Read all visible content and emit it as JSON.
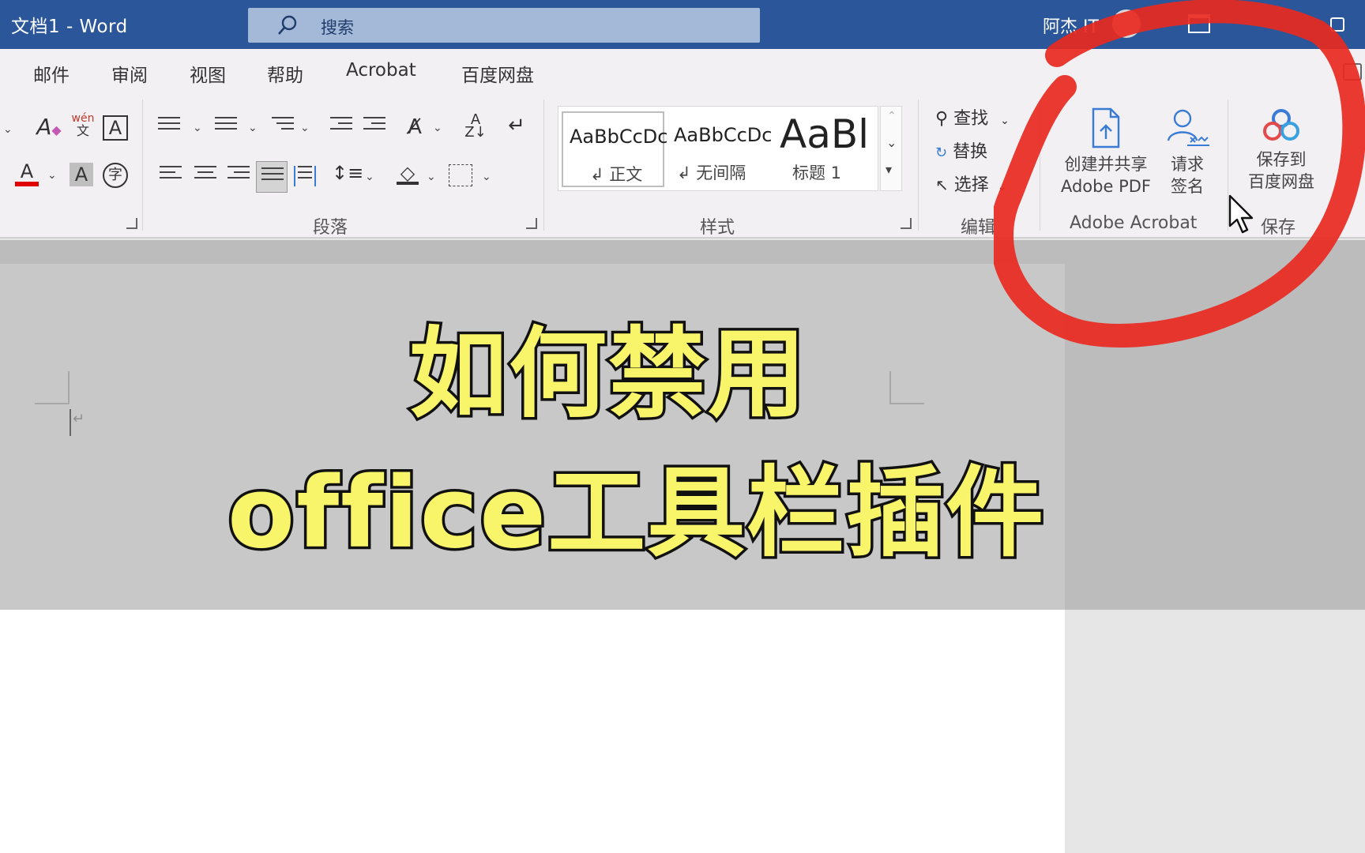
{
  "window": {
    "title": "文档1  -  Word",
    "search_placeholder": "搜索",
    "user_name": "阿杰 IT"
  },
  "tabs": [
    "邮件",
    "审阅",
    "视图",
    "帮助",
    "Acrobat",
    "百度网盘"
  ],
  "ribbon": {
    "font_group": {
      "phonetic_top": "wén",
      "phonetic_bottom": "文",
      "char_border": "A",
      "font_color": "A",
      "char_shading": "A",
      "enclose": "字"
    },
    "paragraph_group": {
      "label": "段落"
    },
    "styles_group": {
      "label": "样式",
      "items": [
        {
          "preview": "AaBbCcDc",
          "name": "↲ 正文"
        },
        {
          "preview": "AaBbCcDc",
          "name": "↲ 无间隔"
        },
        {
          "preview": "AaBl",
          "name": "标题 1"
        }
      ]
    },
    "editing_group": {
      "label": "编辑",
      "find": "查找",
      "replace": "替换",
      "select": "选择"
    },
    "acrobat_group": {
      "label": "Adobe Acrobat",
      "create_line1": "创建并共享",
      "create_line2": "Adobe PDF",
      "sign_line1": "请求",
      "sign_line2": "签名"
    },
    "save_group": {
      "label": "保存",
      "save_line1": "保存到",
      "save_line2": "百度网盘"
    }
  },
  "overlay": {
    "headline_line1": "如何禁用",
    "headline_line2": "office工具栏插件"
  },
  "colors": {
    "title_bar": "#2b579a",
    "ribbon_bg": "#f3f0f3",
    "headline_fill": "#f9f56a",
    "annotation_red": "#e8291f",
    "acrobat_blue": "#3a7bd5"
  }
}
